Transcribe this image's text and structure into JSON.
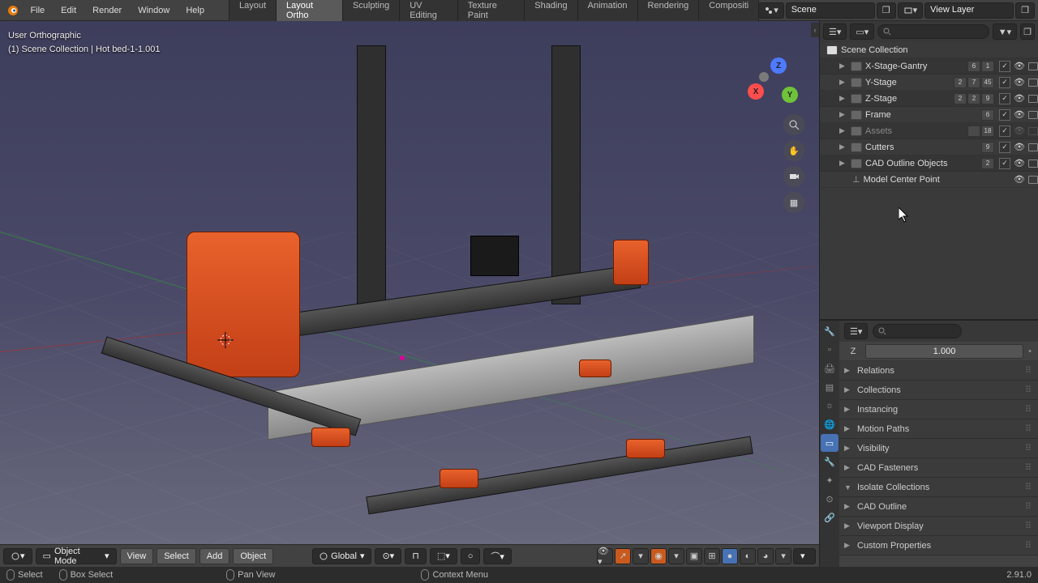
{
  "app": {
    "menus": [
      "File",
      "Edit",
      "Render",
      "Window",
      "Help"
    ],
    "workspaces": [
      "Layout",
      "Layout Ortho",
      "Sculpting",
      "UV Editing",
      "Texture Paint",
      "Shading",
      "Animation",
      "Rendering",
      "Compositi"
    ],
    "active_workspace": "Layout Ortho",
    "scene_label": "Scene",
    "viewlayer_label": "View Layer"
  },
  "viewport": {
    "view_label": "User Orthographic",
    "context_label": "(1) Scene Collection | Hot bed-1-1.001",
    "axes": {
      "x": "X",
      "y": "Y",
      "z": "Z"
    }
  },
  "vp_header": {
    "mode": "Object Mode",
    "view": "View",
    "select": "Select",
    "add": "Add",
    "object": "Object",
    "orientation": "Global"
  },
  "outliner": {
    "root": "Scene Collection",
    "items": [
      {
        "label": "X-Stage-Gantry",
        "badges": [
          "6",
          "1"
        ],
        "check": true,
        "eye": true,
        "screen": true
      },
      {
        "label": "Y-Stage",
        "badges": [
          "2",
          "7",
          "45"
        ],
        "check": true,
        "eye": true,
        "screen": true
      },
      {
        "label": "Z-Stage",
        "badges": [
          "2",
          "2",
          "9"
        ],
        "check": true,
        "eye": true,
        "screen": true
      },
      {
        "label": "Frame",
        "badges": [
          "6"
        ],
        "check": true,
        "eye": true,
        "screen": true
      },
      {
        "label": "Assets",
        "badges": [
          "",
          "18"
        ],
        "check": true,
        "eye": false,
        "screen": false,
        "dim": true
      },
      {
        "label": "Cutters",
        "badges": [
          "9"
        ],
        "check": true,
        "eye": true,
        "screen": true
      },
      {
        "label": "CAD Outline Objects",
        "badges": [
          "2"
        ],
        "check": true,
        "eye": true,
        "screen": true
      }
    ],
    "leaf": {
      "label": "Model Center Point",
      "eye": true,
      "screen": true
    }
  },
  "props": {
    "z_label": "Z",
    "z_value": "1.000",
    "panels": [
      "Relations",
      "Collections",
      "Instancing",
      "Motion Paths",
      "Visibility",
      "CAD Fasteners",
      "Isolate Collections",
      "CAD Outline",
      "Viewport Display",
      "Custom Properties"
    ],
    "open_panel": "Isolate Collections"
  },
  "status": {
    "select": "Select",
    "box": "Box Select",
    "pan": "Pan View",
    "context": "Context Menu",
    "version": "2.91.0"
  },
  "search_placeholder": ""
}
